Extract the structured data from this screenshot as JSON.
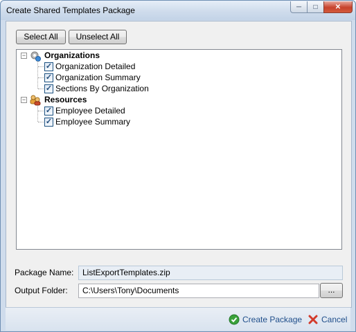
{
  "window": {
    "title": "Create Shared Templates Package"
  },
  "toolbar": {
    "select_all": "Select All",
    "unselect_all": "Unselect All"
  },
  "tree": {
    "groups": [
      {
        "label": "Organizations",
        "expanded": true,
        "icon": "gear-globe-icon",
        "items": [
          {
            "label": "Organization Detailed",
            "checked": true
          },
          {
            "label": "Organization Summary",
            "checked": true
          },
          {
            "label": "Sections By Organization",
            "checked": true
          }
        ]
      },
      {
        "label": "Resources",
        "expanded": true,
        "icon": "people-icon",
        "items": [
          {
            "label": "Employee Detailed",
            "checked": true
          },
          {
            "label": "Employee Summary",
            "checked": true
          }
        ]
      }
    ]
  },
  "form": {
    "package_name_label": "Package Name:",
    "package_name_value": "ListExportTemplates.zip",
    "output_folder_label": "Output Folder:",
    "output_folder_value": "C:\\Users\\Tony\\Documents",
    "browse_label": "..."
  },
  "footer": {
    "create_label": "Create Package",
    "cancel_label": "Cancel"
  },
  "colors": {
    "accent_link": "#1f4e8a",
    "create_icon": "#3aa23a",
    "cancel_icon": "#d23a2a"
  }
}
